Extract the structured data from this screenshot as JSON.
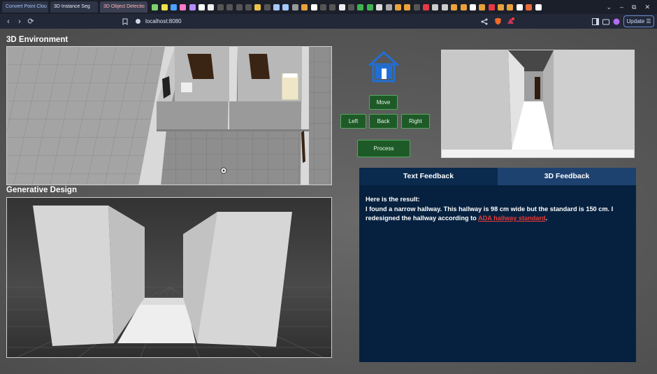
{
  "browser": {
    "tabs": [
      "Convert Point Clou",
      "3D Instance Seg",
      "3D Object Detectio"
    ],
    "url": "localhost:8080",
    "update_label": "Update",
    "nav": {
      "back": "‹",
      "forward": "›",
      "reload": "⟳"
    },
    "controls": {
      "down": "⌄",
      "minimize": "–",
      "restore": "⧉",
      "close": "✕"
    }
  },
  "sections": {
    "environment_title": "3D Environment",
    "generative_title": "Generative Design"
  },
  "controls": {
    "move": "Move",
    "left": "Left",
    "back": "Back",
    "right": "Right",
    "process": "Process"
  },
  "feedback": {
    "tabs": [
      "Text Feedback",
      "3D Feedback"
    ],
    "heading": "Here is the result:",
    "text_before": "I found a narrow hallway. This hallway is 98 cm wide but the standard is 150 cm. I redesigned the hallway according to ",
    "link_text": "ADA hallway standard",
    "text_after": "."
  },
  "colors": {
    "accent_button": "#1e5a27",
    "feedback_bg": "#06213f",
    "tab_inactive": "#1e4270",
    "link": "#e53a3a",
    "home_icon": "#1f6fd6"
  }
}
